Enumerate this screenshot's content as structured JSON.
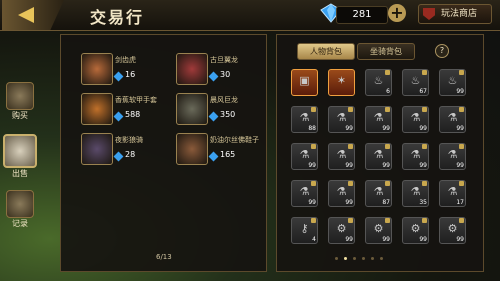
{
  "header": {
    "title": "交易行",
    "currency_amount": "281",
    "shop_label": "玩法商店"
  },
  "nav": [
    {
      "label": "购买",
      "active": false
    },
    {
      "label": "出售",
      "active": true
    },
    {
      "label": "记录",
      "active": false
    }
  ],
  "market": {
    "items": [
      {
        "name": "剑齿虎",
        "price": "16",
        "color": "#b86a3a"
      },
      {
        "name": "古旦翼龙",
        "price": "30",
        "color": "#a03a3a"
      },
      {
        "name": "香蕉软甲手套",
        "price": "588",
        "color": "#c0702a"
      },
      {
        "name": "晨风巨龙",
        "price": "350",
        "color": "#6a6a5a"
      },
      {
        "name": "夜影狼骑",
        "price": "28",
        "color": "#5a4a6a"
      },
      {
        "name": "奶油尔丝佛鞋子",
        "price": "165",
        "color": "#8a5a3a"
      }
    ],
    "page": "6/13"
  },
  "inventory": {
    "tabs": [
      {
        "label": "人物背包",
        "active": true
      },
      {
        "label": "坐骑背包",
        "active": false
      }
    ],
    "help": "?",
    "slots": [
      {
        "q": "",
        "icon": "chest-icon",
        "hl": true
      },
      {
        "q": "",
        "icon": "monster-icon",
        "hl": true
      },
      {
        "q": "6",
        "icon": "bottle-icon"
      },
      {
        "q": "67",
        "icon": "bottle-icon"
      },
      {
        "q": "99",
        "icon": "bottle-icon"
      },
      {
        "q": "88",
        "icon": "vial-icon"
      },
      {
        "q": "99",
        "icon": "vial-icon"
      },
      {
        "q": "99",
        "icon": "vial-icon"
      },
      {
        "q": "99",
        "icon": "vial-icon"
      },
      {
        "q": "99",
        "icon": "vial-icon"
      },
      {
        "q": "99",
        "icon": "vial-icon"
      },
      {
        "q": "99",
        "icon": "vial-icon"
      },
      {
        "q": "99",
        "icon": "vial-icon"
      },
      {
        "q": "99",
        "icon": "vial-icon"
      },
      {
        "q": "99",
        "icon": "vial-icon"
      },
      {
        "q": "99",
        "icon": "vial-icon"
      },
      {
        "q": "99",
        "icon": "vial-icon"
      },
      {
        "q": "87",
        "icon": "vial-icon"
      },
      {
        "q": "35",
        "icon": "vial-icon"
      },
      {
        "q": "17",
        "icon": "vial-icon"
      },
      {
        "q": "4",
        "icon": "key-icon"
      },
      {
        "q": "99",
        "icon": "gear-icon"
      },
      {
        "q": "99",
        "icon": "gear-icon"
      },
      {
        "q": "99",
        "icon": "gear-icon"
      },
      {
        "q": "99",
        "icon": "gear-icon"
      }
    ],
    "page_dots": 6,
    "active_dot": 1
  }
}
